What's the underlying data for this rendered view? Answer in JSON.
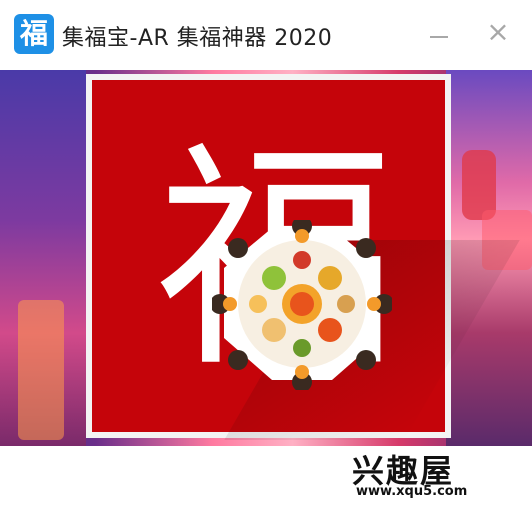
{
  "window": {
    "title": "集福宝-AR 集福神器 2020",
    "icon_glyph": "福",
    "icon_name": "app-fu-icon",
    "minimize_icon": "minimize-icon",
    "close_glyph": "×",
    "close_icon": "close-icon"
  },
  "content": {
    "card_char": "福",
    "card_color": "#c5040a"
  },
  "watermark": {
    "logo_text": "兴趣屋",
    "url": "www.xqu5.com"
  }
}
